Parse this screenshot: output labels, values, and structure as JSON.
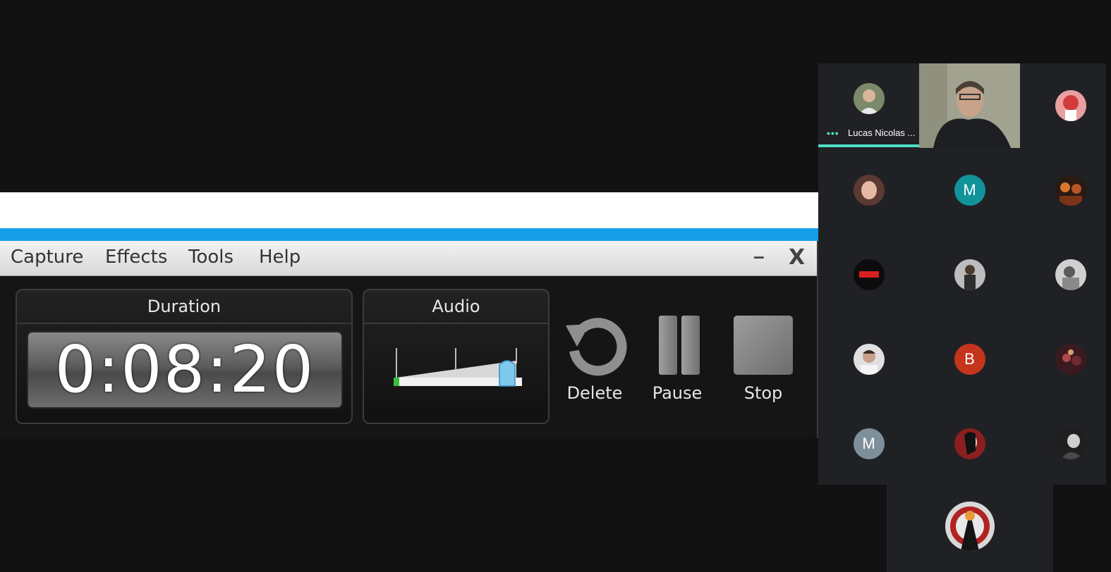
{
  "recorder": {
    "menu": [
      "Capture",
      "Effects",
      "Tools",
      "Help"
    ],
    "minimize_label": "–",
    "close_label": "X",
    "duration_title": "Duration",
    "duration_value": "0:08:20",
    "audio_title": "Audio",
    "audio_level": 0.9,
    "buttons": {
      "delete": "Delete",
      "pause": "Pause",
      "stop": "Stop"
    },
    "colors": {
      "accent_blue": "#169ee9",
      "meter_green": "#3bbf3b",
      "slider_blue": "#7fc8ee"
    }
  },
  "meeting": {
    "active_speaker_name": "Lucas Nicolas ...",
    "speaking_indicator": "•••",
    "accent_color": "#4ddfc6",
    "tiles": [
      {
        "type": "photo",
        "color": "#8a7b62"
      },
      {
        "type": "video",
        "color": "#9c9d8a"
      },
      {
        "type": "photo",
        "color": "#e07070"
      },
      {
        "type": "photo",
        "color": "#5c3a32"
      },
      {
        "type": "letter",
        "letter": "M",
        "color": "#12939a"
      },
      {
        "type": "photo",
        "color": "#b5552a"
      },
      {
        "type": "photo",
        "color": "#0c0c0c"
      },
      {
        "type": "photo",
        "color": "#8d8d8d"
      },
      {
        "type": "photo",
        "color": "#b9b9b9"
      },
      {
        "type": "photo",
        "color": "#cfcfcf"
      },
      {
        "type": "letter",
        "letter": "B",
        "color": "#c5341d"
      },
      {
        "type": "photo",
        "color": "#6e2a30"
      },
      {
        "type": "letter",
        "letter": "M",
        "color": "#7d8f9a"
      },
      {
        "type": "photo",
        "color": "#8b1f1f"
      },
      {
        "type": "photo",
        "color": "#2a2a2a"
      },
      {
        "type": "photo",
        "color": "#3a3a3a"
      }
    ]
  }
}
